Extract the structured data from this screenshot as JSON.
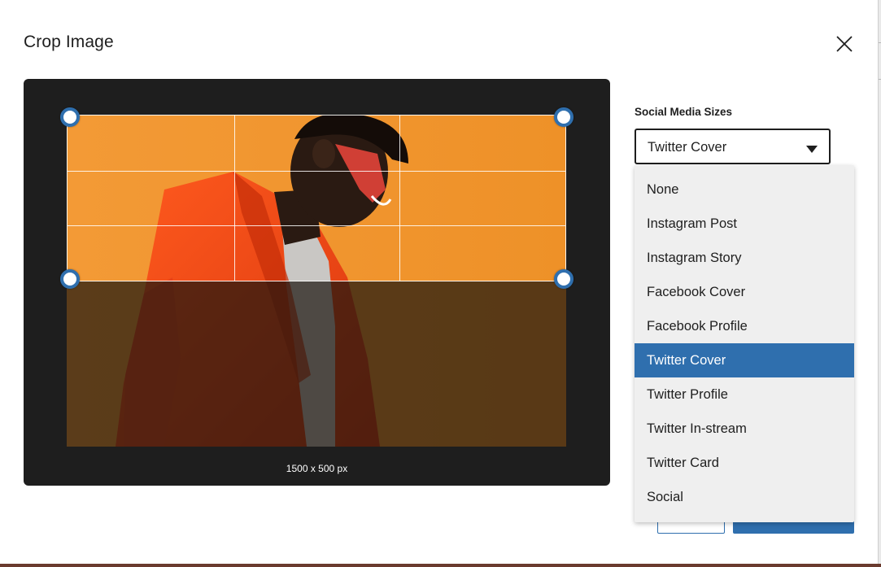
{
  "dialog": {
    "title": "Crop Image"
  },
  "crop": {
    "dimensions_label": "1500 x 500 px"
  },
  "social_sizes": {
    "label": "Social Media Sizes",
    "selected": "Twitter Cover",
    "options": [
      "None",
      "Instagram Post",
      "Instagram Story",
      "Facebook Cover",
      "Facebook Profile",
      "Twitter Cover",
      "Twitter Profile",
      "Twitter In-stream",
      "Twitter Card",
      "Social"
    ]
  },
  "icons": {
    "close": "close-icon",
    "caret": "caret-down-icon",
    "handle": "crop-handle"
  },
  "colors": {
    "accent": "#2f6fae",
    "stage_background": "#1e1e1e",
    "photo_background": "#f0982f",
    "dropdown_background": "#efefef",
    "text": "#1e1e1e"
  }
}
